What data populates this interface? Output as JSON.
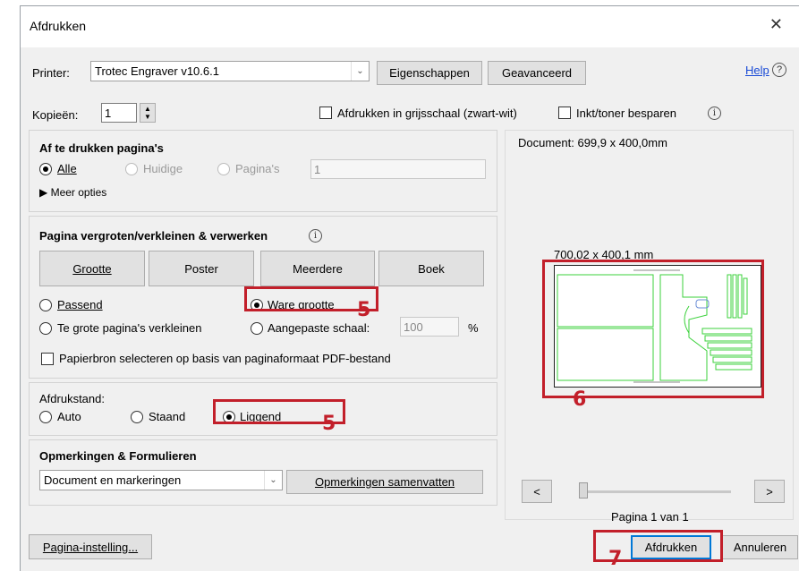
{
  "window": {
    "title": "Afdrukken",
    "close_glyph": "✕"
  },
  "printer": {
    "label": "Printer:",
    "value": "Trotec Engraver v10.6.1",
    "properties_button": "Eigenschappen",
    "advanced_button": "Geavanceerd",
    "help_link": "Help",
    "help_icon": "?"
  },
  "copies": {
    "label": "Kopieën:",
    "value": "1",
    "grayscale_label": "Afdrukken in grijsschaal (zwart-wit)",
    "grayscale_checked": false,
    "save_ink_label": "Inkt/toner besparen",
    "save_ink_checked": false,
    "info_glyph": "i"
  },
  "pages_to_print": {
    "title": "Af te drukken pagina's",
    "options": [
      {
        "label": "Alle",
        "checked": true,
        "disabled": false
      },
      {
        "label": "Huidige",
        "checked": false,
        "disabled": true
      },
      {
        "label": "Pagina's",
        "checked": false,
        "disabled": true
      }
    ],
    "pages_value": "1",
    "more_options": "Meer opties"
  },
  "sizing": {
    "title": "Pagina vergroten/verkleinen & verwerken",
    "tabs": [
      "Grootte",
      "Poster",
      "Meerdere",
      "Boek"
    ],
    "fit_label": "Passend",
    "actual_size_label": "Ware grootte",
    "shrink_label": "Te grote pagina's verkleinen",
    "custom_scale_label": "Aangepaste schaal:",
    "custom_scale_value": "100",
    "percent": "%",
    "paper_source_label": "Papierbron selecteren op basis van paginaformaat PDF-bestand",
    "selected": "Ware grootte"
  },
  "orientation": {
    "title": "Afdrukstand:",
    "options": [
      {
        "label": "Auto",
        "checked": false
      },
      {
        "label": "Staand",
        "checked": false
      },
      {
        "label": "Liggend",
        "checked": true
      }
    ]
  },
  "comments": {
    "title": "Opmerkingen & Formulieren",
    "value": "Document en markeringen",
    "summarize_button": "Opmerkingen samenvatten"
  },
  "preview": {
    "document_size": "Document: 699,9 x 400,0mm",
    "page_size": "700,02 x 400,1 mm",
    "prev": "<",
    "next": ">",
    "page_status": "Pagina 1 van 1"
  },
  "footer": {
    "page_setup": "Pagina-instelling...",
    "print": "Afdrukken",
    "cancel": "Annuleren"
  },
  "annotations": {
    "callout_actual_size": "5",
    "callout_orientation": "5",
    "callout_preview": "6",
    "callout_print": "7",
    "color": "#c21f2a"
  }
}
